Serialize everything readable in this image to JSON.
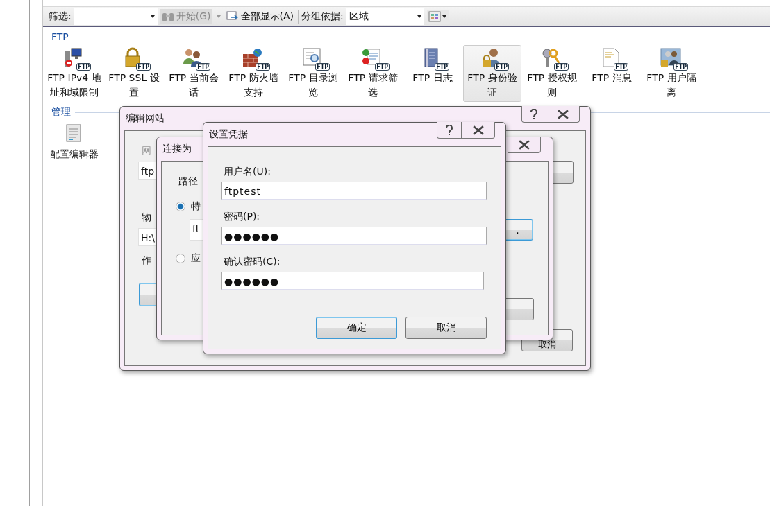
{
  "toolbar": {
    "filter_label": "筛选:",
    "start_button": {
      "label": "开始(G)",
      "disabled": true
    },
    "show_all": "全部显示(A)",
    "group_by_label": "分组依据:",
    "group_by_value": "区域"
  },
  "groups": [
    {
      "title": "FTP",
      "items": [
        {
          "label": "FTP IPv4 地址和域限制",
          "kind": "server",
          "badge": "FTP",
          "selected": false
        },
        {
          "label": "FTP SSL 设置",
          "kind": "lock",
          "badge": "FTP",
          "selected": false
        },
        {
          "label": "FTP 当前会话",
          "kind": "people",
          "badge": "FTP",
          "selected": false
        },
        {
          "label": "FTP 防火墙支持",
          "kind": "wall",
          "badge": "FTP",
          "selected": false
        },
        {
          "label": "FTP 目录浏览",
          "kind": "browse",
          "badge": "FTP",
          "selected": false
        },
        {
          "label": "FTP 请求筛选",
          "kind": "filter",
          "badge": "FTP",
          "selected": false
        },
        {
          "label": "FTP 日志",
          "kind": "log",
          "badge": "FTP",
          "selected": false
        },
        {
          "label": "FTP 身份验证",
          "kind": "auth",
          "badge": "FTP",
          "selected": true
        },
        {
          "label": "FTP 授权规则",
          "kind": "key",
          "badge": "FTP",
          "selected": false
        },
        {
          "label": "FTP 消息",
          "kind": "message",
          "badge": "FTP",
          "selected": false
        },
        {
          "label": "FTP 用户隔离",
          "kind": "isolation",
          "badge": "FTP",
          "selected": false
        }
      ]
    },
    {
      "title": "管理",
      "items": [
        {
          "label": "配置编辑器",
          "kind": "editor",
          "selected": false
        }
      ]
    }
  ],
  "edit_site": {
    "title": "编辑网站",
    "site_label": "网",
    "site_value": "ftp",
    "path_label": "物",
    "path_value": "H:\\",
    "as_label": "作",
    "cancel": "取消"
  },
  "connect_as": {
    "title": "连接为",
    "path_label": "路径",
    "options": [
      {
        "label": "特",
        "selected": true
      },
      {
        "label": "应",
        "selected": false
      }
    ],
    "user_value": "ft",
    "browse": "."
  },
  "credentials": {
    "title": "设置凭据",
    "fields": [
      {
        "label": "用户名(U):",
        "value": "ftptest"
      },
      {
        "label": "密码(P):",
        "value": "●●●●●●"
      },
      {
        "label": "确认密码(C):",
        "value": "●●●●●●"
      }
    ],
    "buttons": [
      {
        "label": "确定",
        "default": true
      },
      {
        "label": "取消",
        "default": false
      }
    ]
  }
}
